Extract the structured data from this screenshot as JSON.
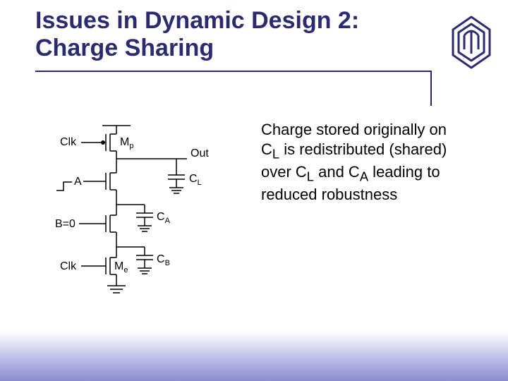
{
  "title": "Issues in Dynamic Design 2: Charge Sharing",
  "body": {
    "line1": "Charge stored originally on",
    "line2_a": "C",
    "line2_a_sub": "L",
    "line2_b": " is redistributed (shared)",
    "line3_a": "over C",
    "line3_a_sub": "L",
    "line3_b": " and C",
    "line3_b_sub": "A",
    "line3_c": " leading to",
    "line4": "reduced robustness"
  },
  "labels": {
    "clk_top": "Clk",
    "clk_bot": "Clk",
    "A": "A",
    "B": "B=0",
    "Out": "Out",
    "Mp": "M",
    "Mp_sub": "p",
    "Me": "M",
    "Me_sub": "e",
    "CL": "C",
    "CL_sub": "L",
    "CA": "C",
    "CA_sub": "A",
    "CB": "C",
    "CB_sub": "B"
  }
}
